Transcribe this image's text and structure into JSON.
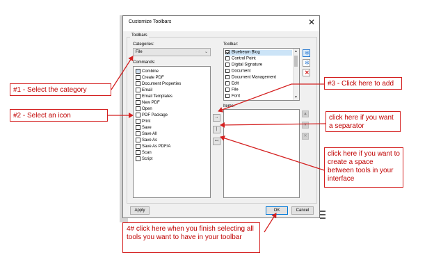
{
  "dialog": {
    "title": "Customize Toolbars",
    "group_label": "Toolbars",
    "categories_label": "Categories:",
    "category_value": "File",
    "commands_label": "Commands:",
    "toolbar_label": "Toolbar:",
    "content_label": "Items:"
  },
  "commands": [
    "Combine",
    "Create PDF",
    "Document Properties",
    "Email",
    "Email Templates",
    "New PDF",
    "Open",
    "PDF Package",
    "Print",
    "Save",
    "Save All",
    "Save As",
    "Save As PDF/A",
    "Scan",
    "Script"
  ],
  "toolbars": [
    {
      "label": "Bluebeam Blog",
      "checked": true
    },
    {
      "label": "Control Point",
      "checked": false
    },
    {
      "label": "Digital Signature",
      "checked": false
    },
    {
      "label": "Document",
      "checked": false
    },
    {
      "label": "Document Management",
      "checked": false
    },
    {
      "label": "Edit",
      "checked": false
    },
    {
      "label": "File",
      "checked": false
    },
    {
      "label": "Font",
      "checked": false
    }
  ],
  "mid_buttons": [
    "→",
    "|",
    "↤"
  ],
  "right_buttons": [
    "▲",
    "▼",
    "✕"
  ],
  "buttons": {
    "apply": "Apply",
    "ok": "OK",
    "cancel": "Cancel"
  },
  "annotations": {
    "select_category": "#1 - Select the category",
    "select_icon": "#2 - Select an icon",
    "click_add": "#3 - Click here to add",
    "separator": "click here if you want a separator",
    "space": "click here if you want to create a space between tools in your interface",
    "finish": "4# click here when you finish selecting all tools you want to have in your toolbar"
  },
  "colors": {
    "annotation_red": "#d42020",
    "accent_blue": "#0078d7"
  }
}
